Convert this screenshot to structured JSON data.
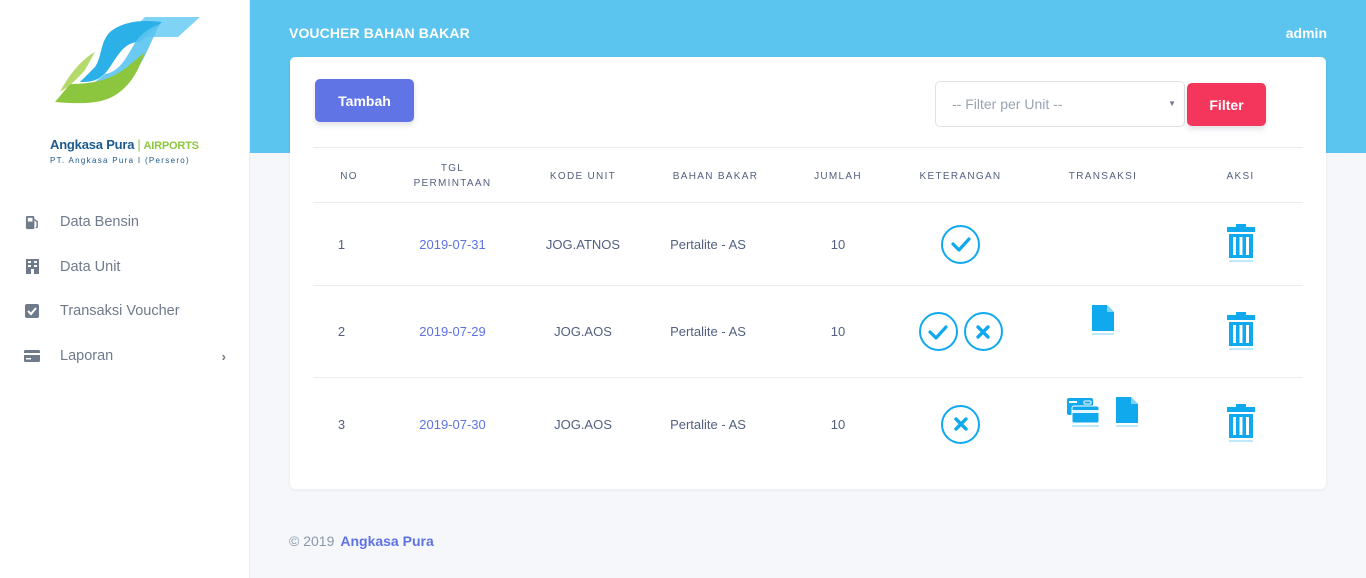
{
  "brand": {
    "name": "Angkasa Pura",
    "divider": "|",
    "suffix": "AIRPORTS",
    "subtitle": "PT. Angkasa Pura I (Persero)",
    "colors": {
      "green": "#8cc63f",
      "blue": "#1c5a8d",
      "cyan": "#5bc4ef"
    }
  },
  "sidebar": {
    "items": [
      {
        "label": "Data Bensin",
        "icon": "gas-pump-icon"
      },
      {
        "label": "Data Unit",
        "icon": "building-icon"
      },
      {
        "label": "Transaksi Voucher",
        "icon": "check-square-icon"
      },
      {
        "label": "Laporan",
        "icon": "credit-card-icon",
        "chevron": "›"
      }
    ]
  },
  "header": {
    "title": "VOUCHER BAHAN BAKAR",
    "user": "admin"
  },
  "toolbar": {
    "add_label": "Tambah",
    "filter_placeholder": "-- Filter per Unit --",
    "filter_label": "Filter",
    "colors": {
      "add": "#6174e6",
      "filter": "#f5365c"
    }
  },
  "table": {
    "columns": [
      "NO",
      "TGL PERMINTAAN",
      "KODE UNIT",
      "BAHAN BAKAR",
      "JUMLAH",
      "KETERANGAN",
      "TRANSAKSI",
      "AKSI"
    ],
    "rows": [
      {
        "no": "1",
        "date": "2019-07-31",
        "unit": "JOG.ATNOS",
        "fuel": "Pertalite - AS",
        "qty": "10",
        "status_icons": [
          "check-circle-icon"
        ],
        "transaction_icons": [],
        "action_icon": "trash-icon"
      },
      {
        "no": "2",
        "date": "2019-07-29",
        "unit": "JOG.AOS",
        "fuel": "Pertalite - AS",
        "qty": "10",
        "status_icons": [
          "check-circle-icon",
          "x-circle-icon"
        ],
        "transaction_icons": [
          "document-icon"
        ],
        "action_icon": "trash-icon"
      },
      {
        "no": "3",
        "date": "2019-07-30",
        "unit": "JOG.AOS",
        "fuel": "Pertalite - AS",
        "qty": "10",
        "status_icons": [
          "x-circle-icon"
        ],
        "transaction_icons": [
          "payment-cards-icon",
          "document-icon"
        ],
        "action_icon": "trash-icon"
      }
    ]
  },
  "footer": {
    "copyright": "© 2019",
    "brand": "Angkasa Pura"
  }
}
